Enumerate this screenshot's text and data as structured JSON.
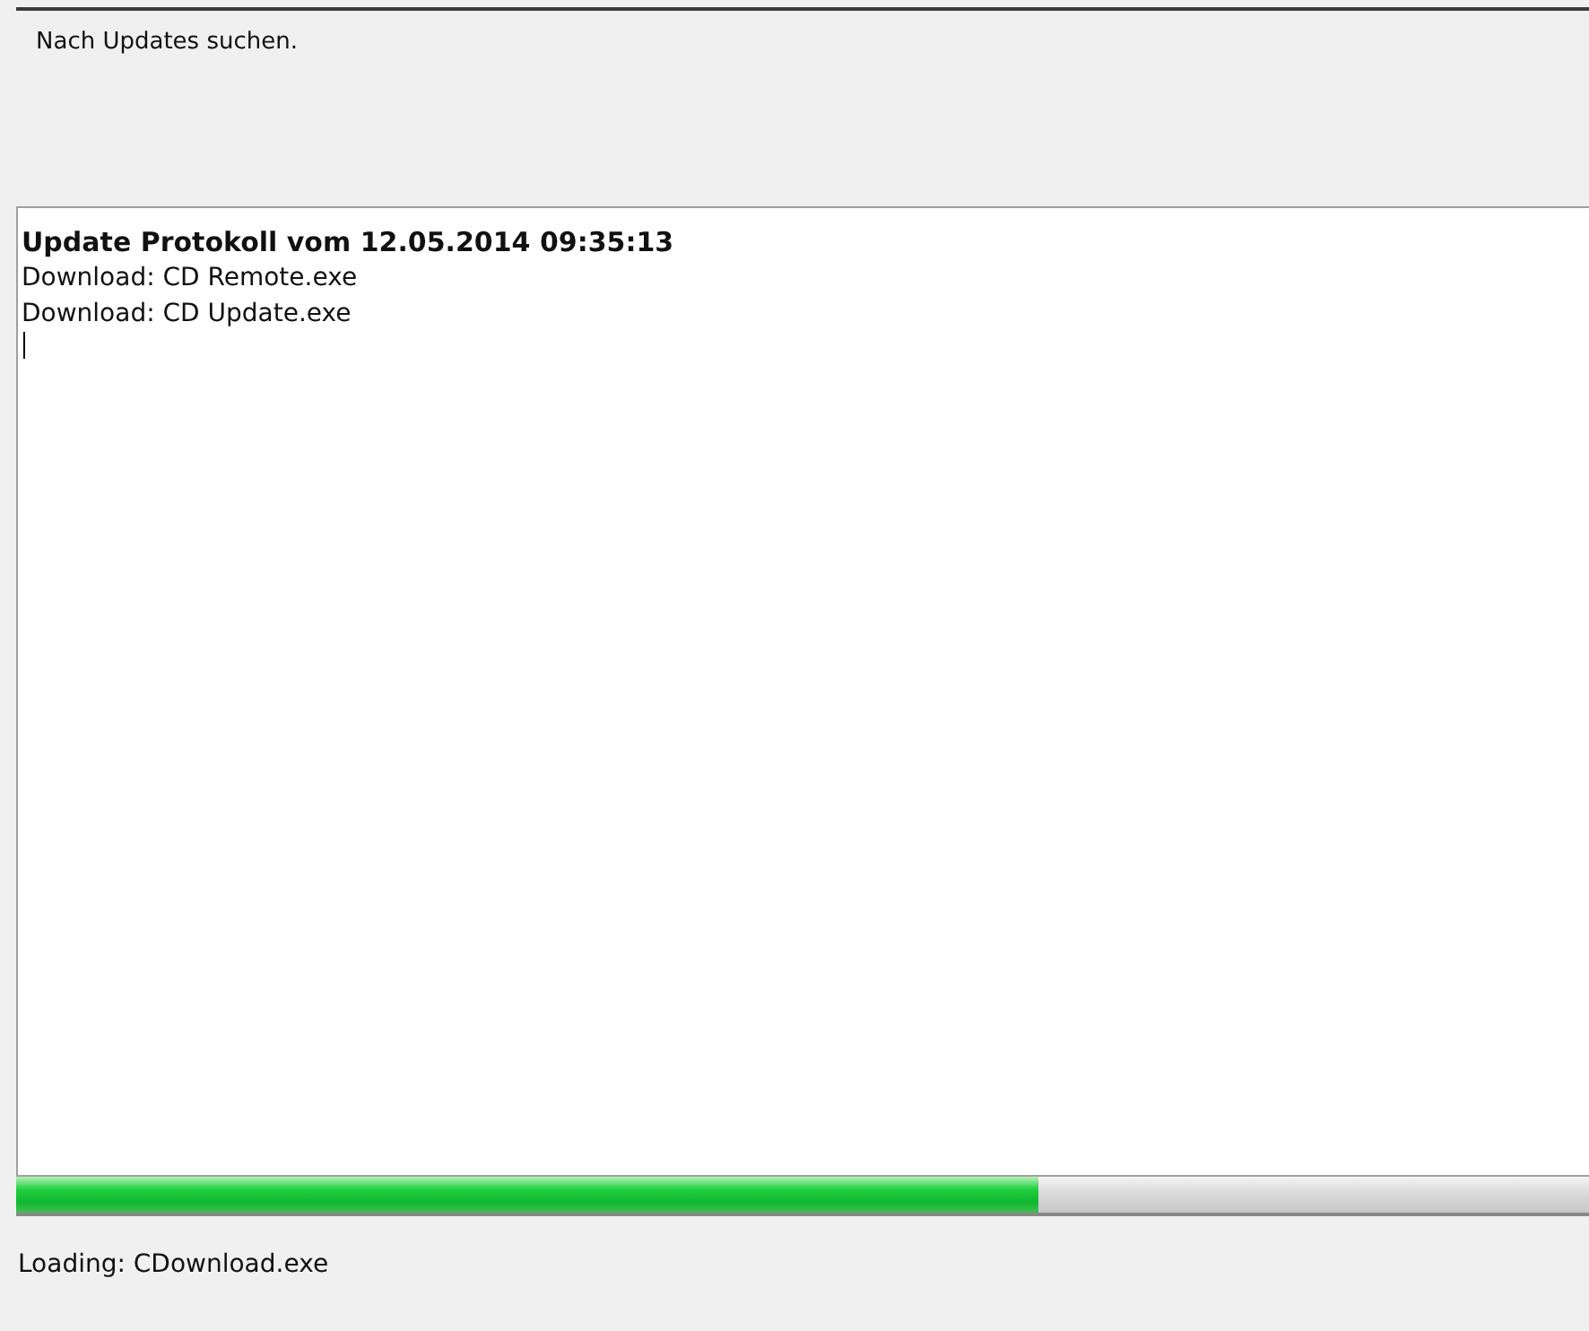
{
  "info": {
    "text": "Nach Updates suchen."
  },
  "log": {
    "title": "Update Protokoll vom 12.05.2014 09:35:13",
    "lines": [
      "Download: CD Remote.exe",
      "Download: CD Update.exe"
    ]
  },
  "progress": {
    "level": 0.65
  },
  "status": {
    "text": "Loading: CDownload.exe"
  }
}
